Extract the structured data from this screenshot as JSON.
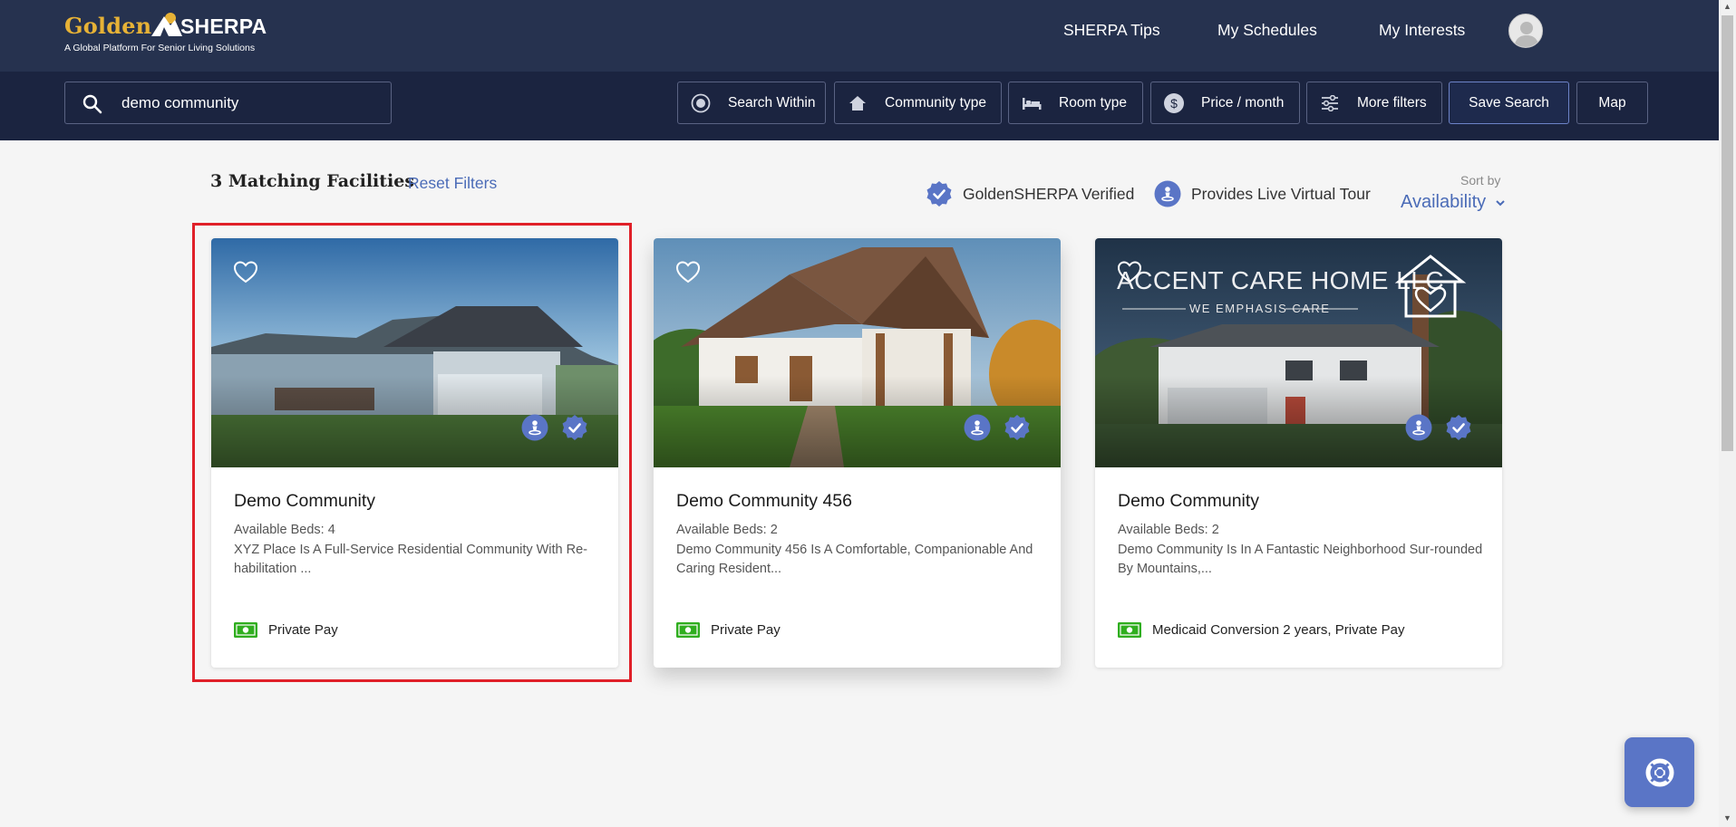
{
  "brand": {
    "name_golden": "Golden",
    "name_sherpa": "SHERPA",
    "tagline": "A Global Platform For Senior Living Solutions"
  },
  "nav": {
    "tips": "SHERPA Tips",
    "schedules": "My Schedules",
    "interests": "My Interests"
  },
  "search": {
    "value": "demo community"
  },
  "filters": {
    "search_within": "Search Within",
    "community_type": "Community type",
    "room_type": "Room type",
    "price": "Price / month",
    "more": "More filters",
    "save": "Save Search",
    "map": "Map"
  },
  "results": {
    "count_label": "3 Matching Facilities",
    "reset_label": "Reset Filters",
    "legend_verified": "GoldenSHERPA Verified",
    "legend_tour": "Provides Live Virtual Tour",
    "sort_label": "Sort by",
    "sort_value": "Availability"
  },
  "cards": [
    {
      "name": "Demo Community",
      "beds": "Available Beds: 4",
      "desc": "XYZ Place Is A Full-Service Residential Community With Re-habilitation ...",
      "payment": "Private Pay"
    },
    {
      "name": "Demo Community 456",
      "beds": "Available Beds: 2",
      "desc": "Demo Community 456 Is A Comfortable, Companionable And Caring Resident...",
      "payment": "Private Pay"
    },
    {
      "name": "Demo Community",
      "beds": "Available Beds: 2",
      "desc": "Demo Community Is In A Fantastic Neighborhood Sur-rounded By Mountains,...",
      "payment": "Medicaid Conversion 2 years, Private Pay",
      "image_sign_title": "ACCENT CARE HOME LLC",
      "image_sign_sub": "WE EMPHASIS CARE"
    }
  ],
  "colors": {
    "header": "#26324f",
    "filterbar": "#1b2440",
    "accent": "#4a6bb7",
    "badge": "#5a75c6",
    "highlight": "#e02029",
    "money": "#2fae1e"
  },
  "icons": [
    "search-icon",
    "radio-target-icon",
    "home-icon",
    "bed-icon",
    "dollar-icon",
    "sliders-icon",
    "heart-icon",
    "verified-badge-icon",
    "virtual-tour-icon",
    "money-icon",
    "chevron-down-icon",
    "lifebuoy-icon"
  ]
}
